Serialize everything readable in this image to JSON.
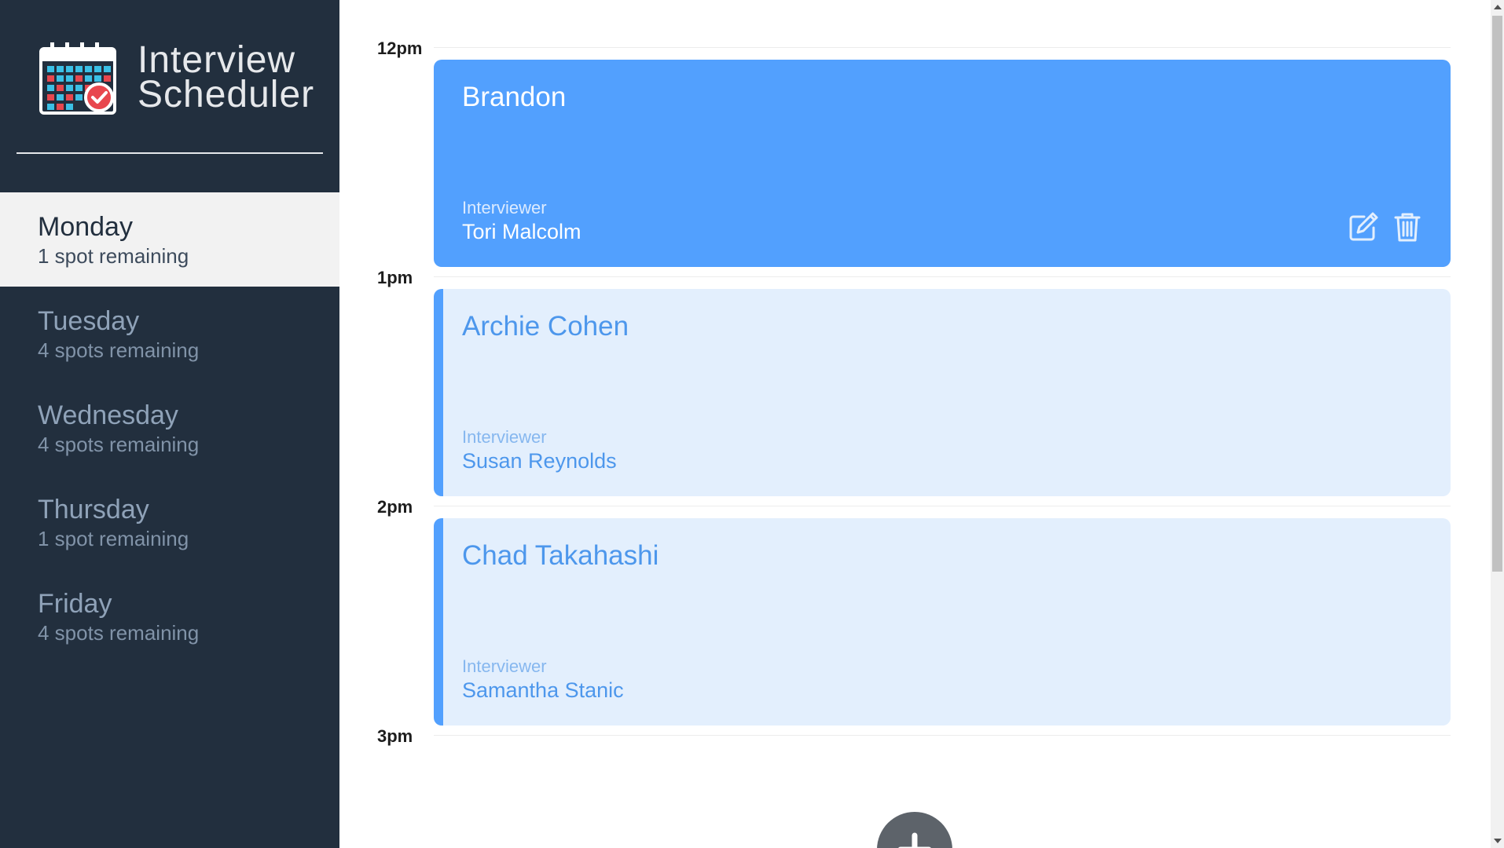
{
  "app": {
    "title_line1": "Interview",
    "title_line2": "Scheduler"
  },
  "sidebar": {
    "days": [
      {
        "name": "Monday",
        "spots": "1 spot remaining",
        "selected": true
      },
      {
        "name": "Tuesday",
        "spots": "4 spots remaining",
        "selected": false
      },
      {
        "name": "Wednesday",
        "spots": "4 spots remaining",
        "selected": false
      },
      {
        "name": "Thursday",
        "spots": "1 spot remaining",
        "selected": false
      },
      {
        "name": "Friday",
        "spots": "4 spots remaining",
        "selected": false
      }
    ]
  },
  "schedule": {
    "times": [
      "12pm",
      "1pm",
      "2pm",
      "3pm"
    ],
    "appointments": [
      {
        "student": "Brandon",
        "interviewer_label": "Interviewer",
        "interviewer": "Tori Malcolm",
        "state": "active"
      },
      {
        "student": "Archie Cohen",
        "interviewer_label": "Interviewer",
        "interviewer": "Susan Reynolds",
        "state": "booked"
      },
      {
        "student": "Chad Takahashi",
        "interviewer_label": "Interviewer",
        "interviewer": "Samantha Stanic",
        "state": "booked"
      }
    ]
  },
  "icons": {
    "logo": "calendar-check-icon",
    "edit": "edit-icon",
    "delete": "trash-icon",
    "add": "plus-icon"
  },
  "colors": {
    "sidebar_bg": "#222f3e",
    "accent": "#52a0fe",
    "booked_bg": "#e3effd",
    "selected_day_bg": "#f2f2f2"
  }
}
